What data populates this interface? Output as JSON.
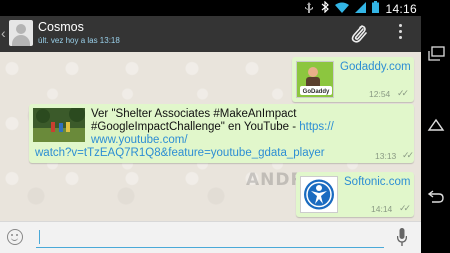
{
  "status_bar": {
    "time": "14:16",
    "icons": [
      "usb-icon",
      "bluetooth-icon",
      "wifi-icon",
      "signal-icon",
      "battery-icon"
    ]
  },
  "header": {
    "contact_name": "Cosmos",
    "last_seen": "últ. vez hoy a las 13:18",
    "icons": [
      "back-icon",
      "avatar",
      "attach-icon",
      "overflow-menu-icon"
    ]
  },
  "messages": [
    {
      "type": "link",
      "text": "Godaddy.com",
      "time": "12:54",
      "ticks": "✓✓",
      "thumb_label": "GoDaddy"
    },
    {
      "type": "youtube",
      "text": "Ver \"Shelter Associates  #MakeAnImpact #GoogleImpactChallenge\" en YouTube - ",
      "link_part1": "https://",
      "link_part2": "www.youtube.com/",
      "link_part3": "watch?v=tTzEAQ7R1Q8&feature=youtube_gdata_player",
      "time": "13:13",
      "ticks": "✓✓"
    },
    {
      "type": "link",
      "text": "Softonic.com",
      "time": "14:14",
      "ticks": "✓✓"
    }
  ],
  "watermark": "ANDROID",
  "input": {
    "value": "",
    "placeholder": ""
  },
  "colors": {
    "bubble": "#e1f7cb",
    "link": "#2d8ed4",
    "action_bar": "#343434",
    "accent": "#4aa9d8"
  }
}
